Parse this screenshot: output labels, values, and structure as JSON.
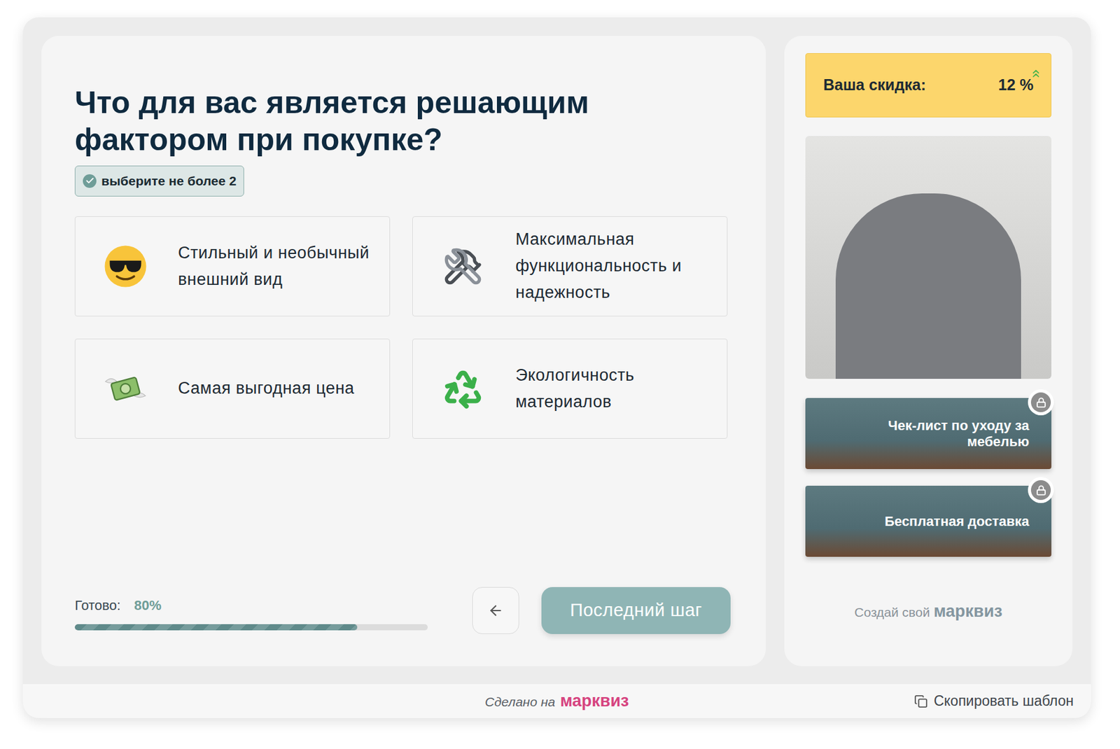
{
  "question": {
    "title": "Что для вас является решающим фактором при покупке?",
    "hint": "выберите не более 2"
  },
  "options": [
    {
      "label": "Стильный и необычный внешний вид",
      "selected": false
    },
    {
      "label": "Максимальная функциональность и надежность",
      "selected": false
    },
    {
      "label": "Самая выгодная цена",
      "selected": false
    },
    {
      "label": "Экологичность материалов",
      "selected": false
    }
  ],
  "progress": {
    "label": "Готово:",
    "value": "80%",
    "level": 0.8
  },
  "nav": {
    "next": "Последний шаг",
    "next_disabled": true
  },
  "discount": {
    "label": "Ваша скидка:",
    "value": "12 %"
  },
  "rewards": [
    {
      "label": "Чек-лист по уходу за мебелью",
      "locked": true
    },
    {
      "label": "Бесплатная доставка",
      "locked": true
    }
  ],
  "branding": {
    "prefix": "Создай свой",
    "logo": "марквиз"
  },
  "footer": {
    "made_prefix": "Сделано на",
    "made_logo": "марквиз",
    "copy": "Скопировать шаблон"
  }
}
